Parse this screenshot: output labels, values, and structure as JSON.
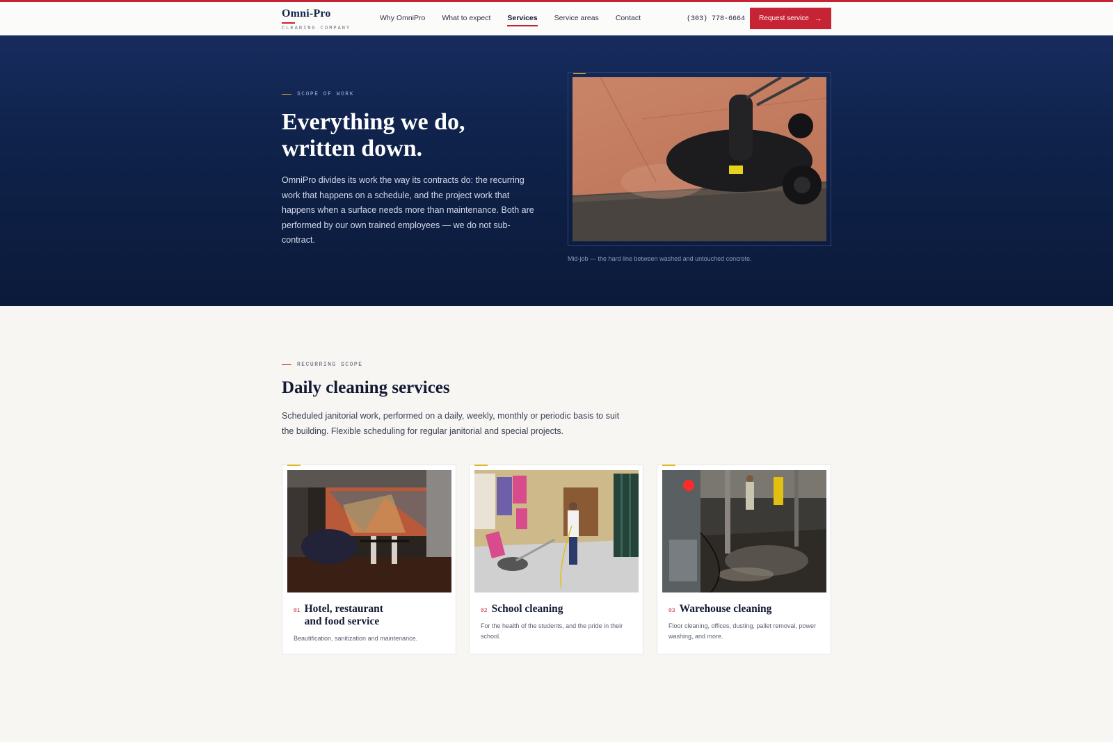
{
  "header": {
    "brand_name": "Omni-Pro",
    "brand_sub": "CLEANING COMPANY",
    "nav": [
      "Why OmniPro",
      "What to expect",
      "Services",
      "Service areas",
      "Contact"
    ],
    "active_nav": "Services",
    "phone": "(303) 778-6664",
    "cta_label": "Request service",
    "cta_icon": "arrow-right-icon"
  },
  "hero": {
    "eyebrow": "SCOPE OF WORK",
    "title": "Everything we do, written down.",
    "body": "OmniPro divides its work the way its contracts do: the recurring work that happens on a schedule, and the project work that happens when a surface needs more than maintenance. Both are performed by our own trained employees — we do not sub-contract.",
    "caption": "Mid-job — the hard line between washed and untouched concrete."
  },
  "recurring": {
    "eyebrow": "RECURRING SCOPE",
    "title": "Daily cleaning services",
    "body": "Scheduled janitorial work, performed on a daily, weekly, monthly or periodic basis to suit the building. Flexible scheduling for regular janitorial and special projects.",
    "cards": [
      {
        "num": "01",
        "title": "Hotel, restaurant and food service",
        "text": "Beautification, sanitization and maintenance."
      },
      {
        "num": "02",
        "title": "School cleaning",
        "text": "For the health of the students, and the pride in their school."
      },
      {
        "num": "03",
        "title": "Warehouse cleaning",
        "text": "Floor cleaning, offices, dusting, pallet removal, power washing, and more."
      }
    ]
  },
  "colors": {
    "accent_red": "#c62334",
    "accent_gold": "#e3b526",
    "navy": "#0f224a"
  }
}
